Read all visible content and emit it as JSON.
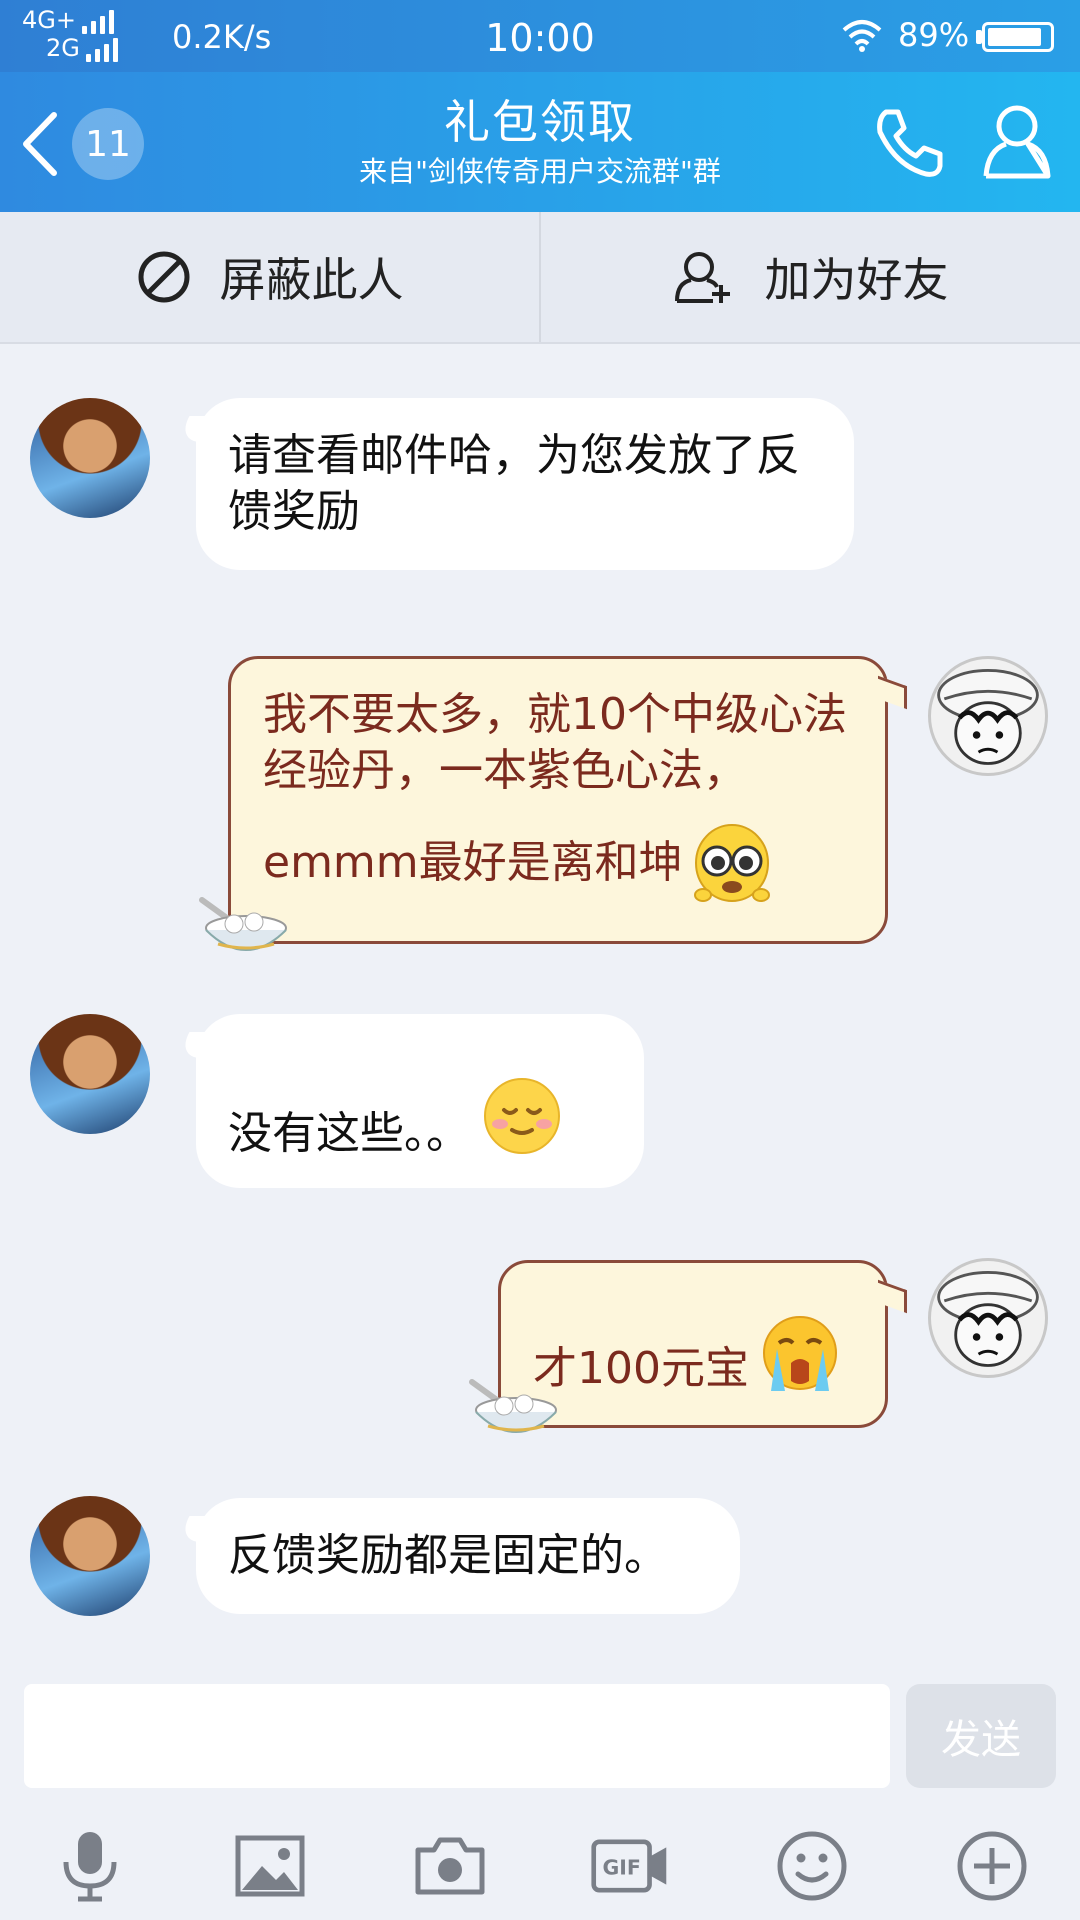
{
  "status_bar": {
    "network_top": "4G+",
    "network_bottom": "2G",
    "speed": "0.2K/s",
    "time": "10:00",
    "battery": "89%",
    "battery_level": 0.89
  },
  "header": {
    "unread_count": "11",
    "title": "礼包领取",
    "subtitle": "来自\"剑侠传奇用户交流群\"群"
  },
  "actions": {
    "block": "屏蔽此人",
    "add_friend": "加为好友"
  },
  "messages": [
    {
      "side": "in",
      "text": "请查看邮件哈，为您发放了反馈奖励"
    },
    {
      "side": "out",
      "text_line1": "我不要太多，就10个中级心法经验丹，一本紫色心法，",
      "text_line2": "emmm最好是离和坤",
      "emoji": "pleading-face"
    },
    {
      "side": "in",
      "text": "没有这些。。",
      "emoji": "smile-face"
    },
    {
      "side": "out",
      "text": "才100元宝",
      "emoji": "crying-face"
    },
    {
      "side": "in",
      "text": "反馈奖励都是固定的。"
    }
  ],
  "input": {
    "value": "",
    "send_label": "发送"
  },
  "toolbar": [
    "mic-icon",
    "image-icon",
    "camera-icon",
    "gif-icon",
    "emoji-icon",
    "plus-icon"
  ],
  "colors": {
    "header_start": "#2f8ae0",
    "header_end": "#23b6f0",
    "bubble_out_bg": "#fdf6dc",
    "bubble_out_text": "#7b2a1e"
  }
}
